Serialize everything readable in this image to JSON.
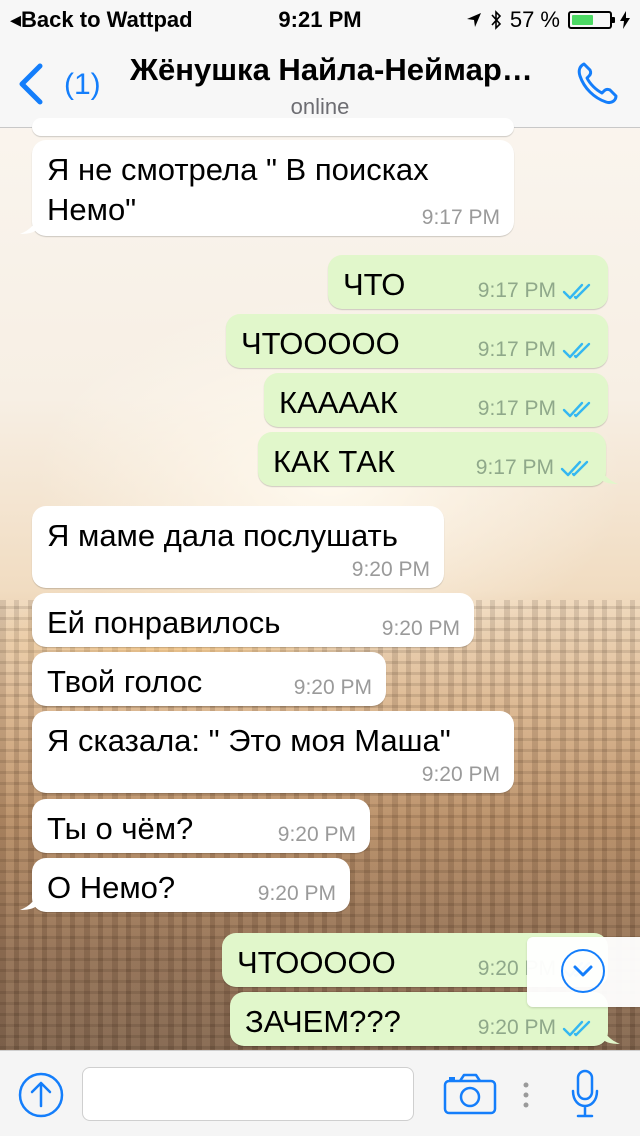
{
  "status_bar": {
    "back_label": "Back to Wattpad",
    "time": "9:21 PM",
    "battery": "57 %",
    "battery_level": 0.57
  },
  "header": {
    "back_count": "(1)",
    "contact_name": "Жёнушка Найла-Неймар…",
    "status": "online"
  },
  "messages": [
    {
      "dir": "in",
      "lines": [
        "Я не смотрела \" В поисках",
        "Немо\""
      ],
      "time": "9:17 PM"
    },
    {
      "dir": "out",
      "lines": [
        "ЧТО"
      ],
      "time": "9:17 PM",
      "read": true
    },
    {
      "dir": "out",
      "lines": [
        "ЧТООООО"
      ],
      "time": "9:17 PM",
      "read": true
    },
    {
      "dir": "out",
      "lines": [
        "КААААК"
      ],
      "time": "9:17 PM",
      "read": true
    },
    {
      "dir": "out",
      "lines": [
        "КАК ТАК"
      ],
      "time": "9:17 PM",
      "read": true
    },
    {
      "dir": "in",
      "lines": [
        "Я маме дала послушать"
      ],
      "time": "9:20 PM"
    },
    {
      "dir": "in",
      "lines": [
        "Ей понравилось"
      ],
      "time": "9:20 PM"
    },
    {
      "dir": "in",
      "lines": [
        "Твой голос"
      ],
      "time": "9:20 PM"
    },
    {
      "dir": "in",
      "lines": [
        "Я сказала: \" Это моя Маша\""
      ],
      "time": "9:20 PM"
    },
    {
      "dir": "in",
      "lines": [
        "Ты о чём?"
      ],
      "time": "9:20 PM"
    },
    {
      "dir": "in",
      "lines": [
        "О Немо?"
      ],
      "time": "9:20 PM"
    },
    {
      "dir": "out",
      "lines": [
        "ЧТООООО"
      ],
      "time": "9:20 PM",
      "read": true
    },
    {
      "dir": "out",
      "lines": [
        "ЗАЧЕМ???"
      ],
      "time": "9:20 PM",
      "read": true
    }
  ],
  "composer": {
    "placeholder": "",
    "value": ""
  },
  "colors": {
    "accent": "#147efb",
    "outgoing_bubble": "#e1f7cb",
    "incoming_bubble": "#ffffff",
    "read_ticks": "#34b7f1"
  }
}
